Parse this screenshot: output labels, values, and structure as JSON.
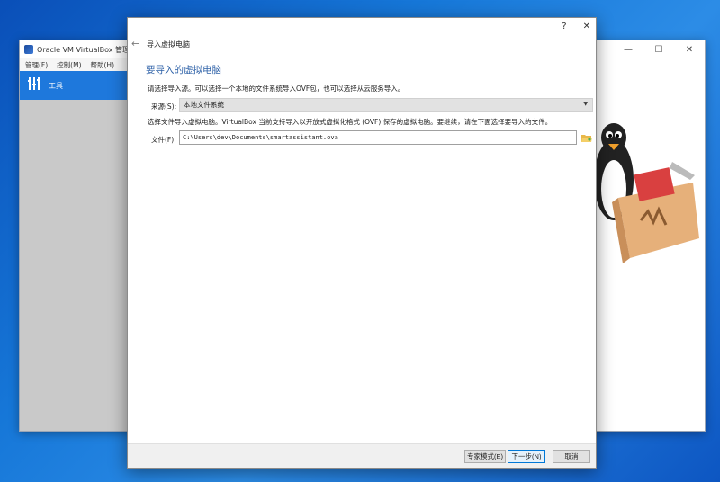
{
  "colors": {
    "desktop": "#1677d8",
    "accent_blue": "#1e78dc",
    "heading_blue": "#2f62a8",
    "left_pane_gray": "#c9c9c9"
  },
  "manager": {
    "title": "Oracle VM VirtualBox 管理器",
    "menu": [
      "管理(F)",
      "控制(M)",
      "帮助(H)"
    ],
    "tools_label": "工具",
    "controls": {
      "minimize": "—",
      "maximize": "☐",
      "close": "✕"
    }
  },
  "wizard": {
    "title_controls": {
      "help": "?",
      "close": "✕"
    },
    "back_icon": "←",
    "title": "导入虚拟电脑",
    "heading": "要导入的虚拟电脑",
    "intro": "请选择导入源。可以选择一个本地的文件系统导入OVF包，也可以选择从云服务导入。",
    "source_label": "来源(S):",
    "source_value": "本地文件系统",
    "description": "选择文件导入虚拟电脑。VirtualBox 当前支持导入以开放式虚拟化格式 (OVF) 保存的虚拟电脑。要继续，请在下面选择要导入的文件。",
    "file_label": "文件(F):",
    "file_value": "C:\\Users\\dev\\Documents\\smartassistant.ova",
    "buttons": {
      "expert": "专家模式(E)",
      "next": "下一步(N)",
      "cancel": "取消"
    }
  }
}
